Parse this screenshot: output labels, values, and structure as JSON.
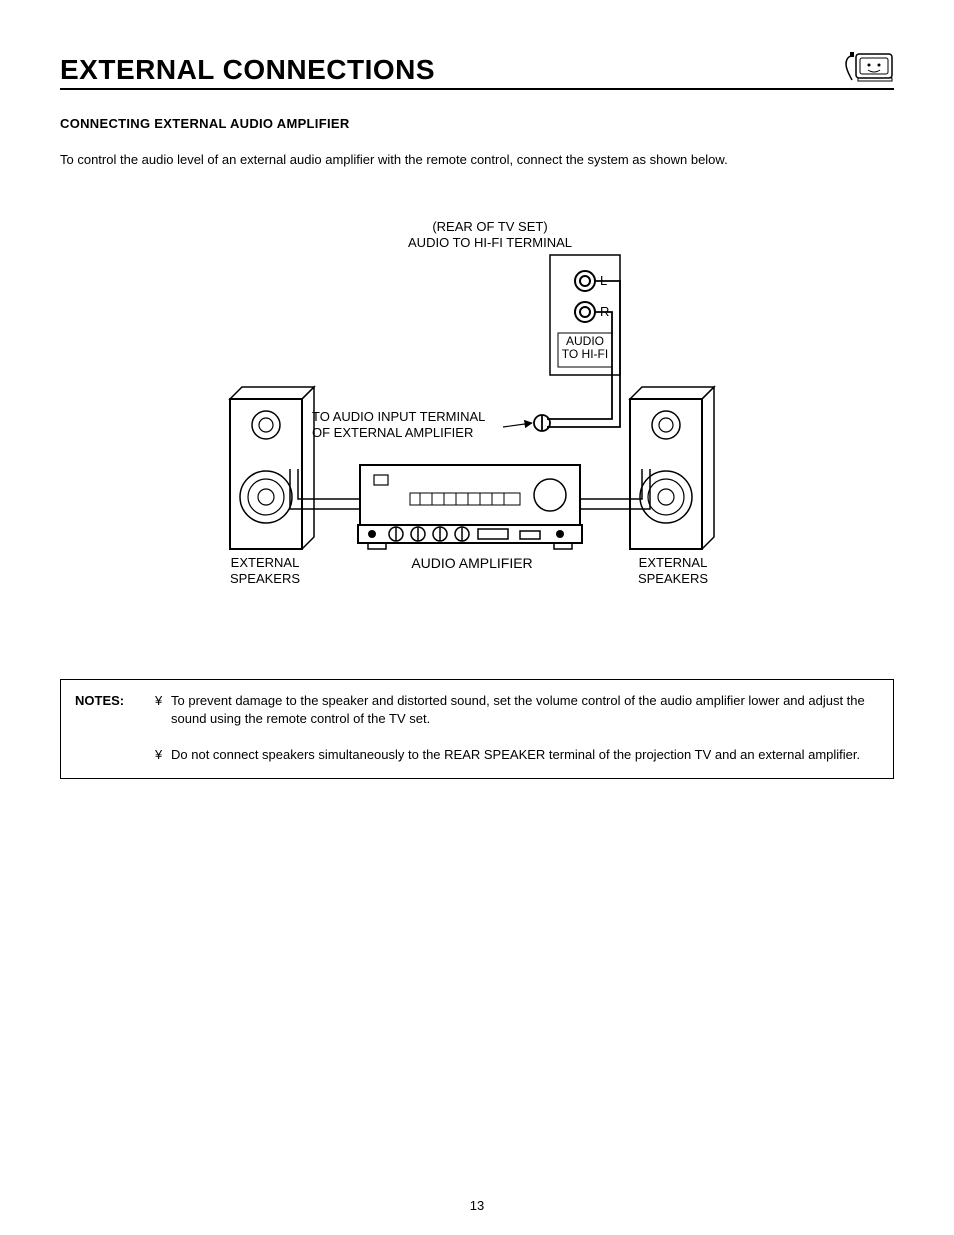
{
  "header": {
    "title": "EXTERNAL CONNECTIONS"
  },
  "subheading": "CONNECTING EXTERNAL AUDIO AMPLIFIER",
  "intro": "To control the audio level of an external audio amplifier with the remote control, connect the system as shown below.",
  "diagram": {
    "rear_of_tv_line1": "(REAR OF TV SET)",
    "rear_of_tv_line2": "AUDIO TO HI-FI TERMINAL",
    "jack_L": "L",
    "jack_R": "R",
    "hifi_box_line1": "AUDIO",
    "hifi_box_line2": "TO HI-FI",
    "to_audio_input_line1": "TO AUDIO INPUT TERMINAL",
    "to_audio_input_line2": "OF EXTERNAL AMPLIFIER",
    "amp_label": "AUDIO AMPLIFIER",
    "ext_speakers_left": "EXTERNAL\nSPEAKERS",
    "ext_speakers_right": "EXTERNAL\nSPEAKERS"
  },
  "notes": {
    "heading": "NOTES:",
    "bullet": "¥",
    "item1": "To prevent damage to the speaker and distorted sound, set the volume control of the audio amplifier lower and adjust the sound using the remote control of the TV set.",
    "item2": "Do not connect speakers simultaneously to the REAR SPEAKER terminal of the projection TV and an external amplifier."
  },
  "page_number": "13"
}
